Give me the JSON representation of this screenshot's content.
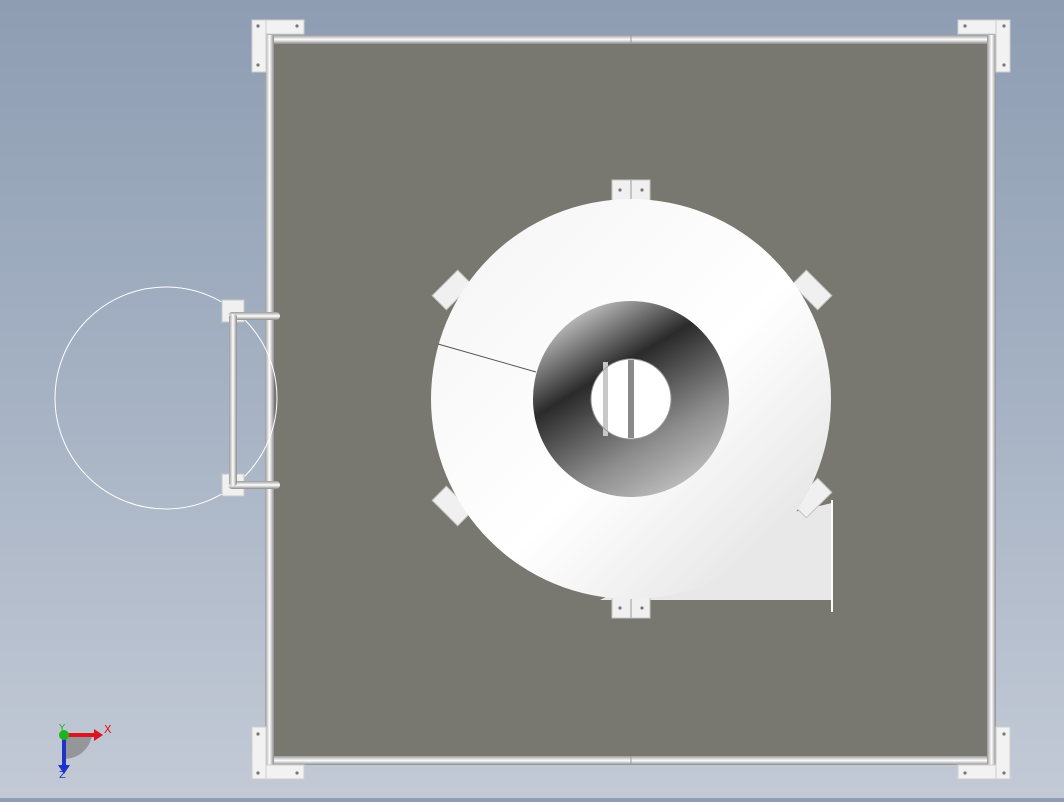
{
  "viewport": {
    "background_top": "#8e9db2",
    "background_bottom": "#c3cad6",
    "panel_color": "#787870",
    "frame_color": "#e6e6e6"
  },
  "triad": {
    "x_label": "X",
    "y_label": "Y",
    "z_label": "Z",
    "x_color": "#e0141e",
    "y_color": "#1eb41e",
    "z_color": "#1e32c8"
  }
}
